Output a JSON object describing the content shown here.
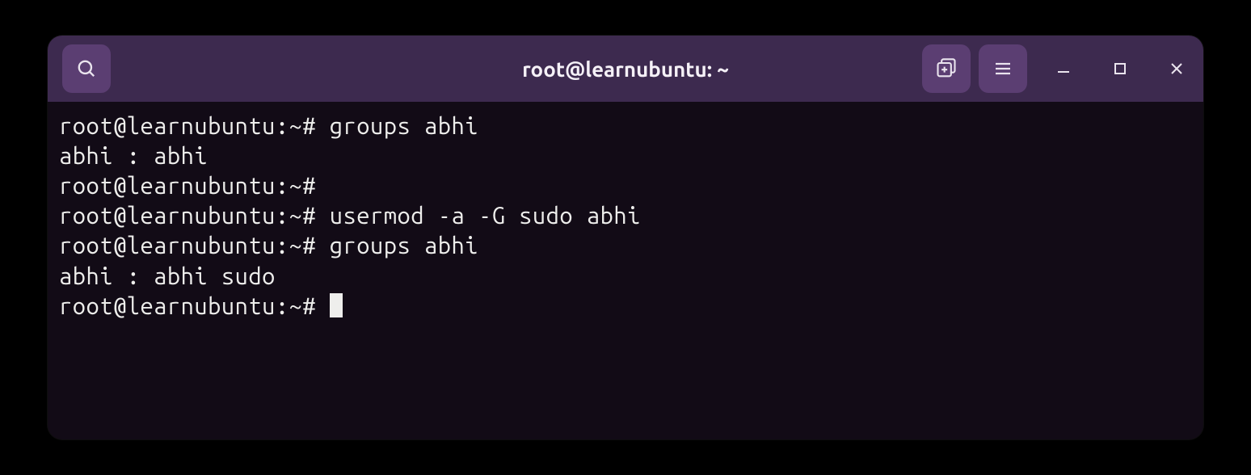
{
  "titlebar": {
    "title": "root@learnubuntu: ~"
  },
  "terminal": {
    "lines": [
      "root@learnubuntu:~# groups abhi",
      "abhi : abhi",
      "root@learnubuntu:~# ",
      "root@learnubuntu:~# usermod -a -G sudo abhi",
      "root@learnubuntu:~# groups abhi",
      "abhi : abhi sudo",
      "root@learnubuntu:~# "
    ]
  }
}
